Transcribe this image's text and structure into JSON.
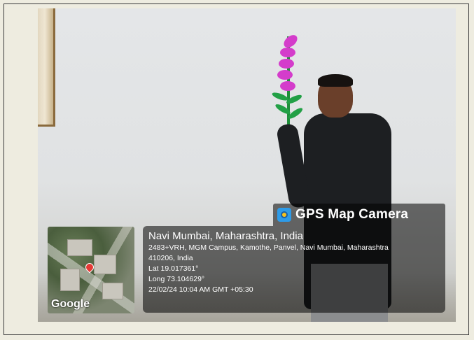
{
  "gps_app": {
    "title": "GPS Map Camera",
    "icon": "gps-map-camera-icon"
  },
  "location": {
    "city_line": "Navi Mumbai, Maharashtra, India",
    "address_line1": "2483+VRH, MGM Campus, Kamothe, Panvel, Navi Mumbai, Maharashtra",
    "address_line2": "410206, India",
    "lat": "Lat 19.017361°",
    "long": "Long 73.104629°",
    "datetime": "22/02/24 10:04 AM GMT +05:30"
  },
  "map": {
    "provider_label": "Google"
  },
  "colors": {
    "page_bg": "#eeece0",
    "overlay": "rgba(0,0,0,.55)",
    "flower_pink": "#d43ccb",
    "flower_green": "#22a046"
  }
}
